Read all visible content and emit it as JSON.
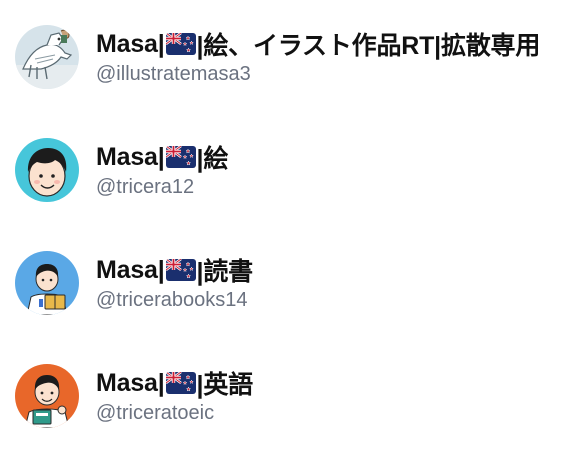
{
  "accounts": [
    {
      "name_prefix": "Masa|",
      "name_suffix": "|絵、イラスト作品RT|拡散専用",
      "flag_icon": "new-zealand-flag-icon",
      "handle": "@illustratemasa3",
      "avatar_icon": "dinosaur-skeleton-illustration-avatar",
      "avatar_bg": "#c9dde8"
    },
    {
      "name_prefix": "Masa|",
      "name_suffix": "|絵",
      "flag_icon": "new-zealand-flag-icon",
      "handle": "@tricera12",
      "avatar_icon": "smiling-boy-avatar",
      "avatar_bg": "#46c6da"
    },
    {
      "name_prefix": "Masa|",
      "name_suffix": "|読書",
      "flag_icon": "new-zealand-flag-icon",
      "handle": "@tricerabooks14",
      "avatar_icon": "boy-reading-book-avatar",
      "avatar_bg": "#5aa8e6"
    },
    {
      "name_prefix": "Masa|",
      "name_suffix": "|英語",
      "flag_icon": "new-zealand-flag-icon",
      "handle": "@triceratoeic",
      "avatar_icon": "boy-with-textbook-avatar",
      "avatar_bg": "#e8672a"
    }
  ],
  "colors": {
    "name_text": "#111111",
    "handle_text": "#6b7280",
    "background": "#ffffff",
    "flag_blue": "#1a2f6e",
    "flag_red": "#cc1e35"
  }
}
